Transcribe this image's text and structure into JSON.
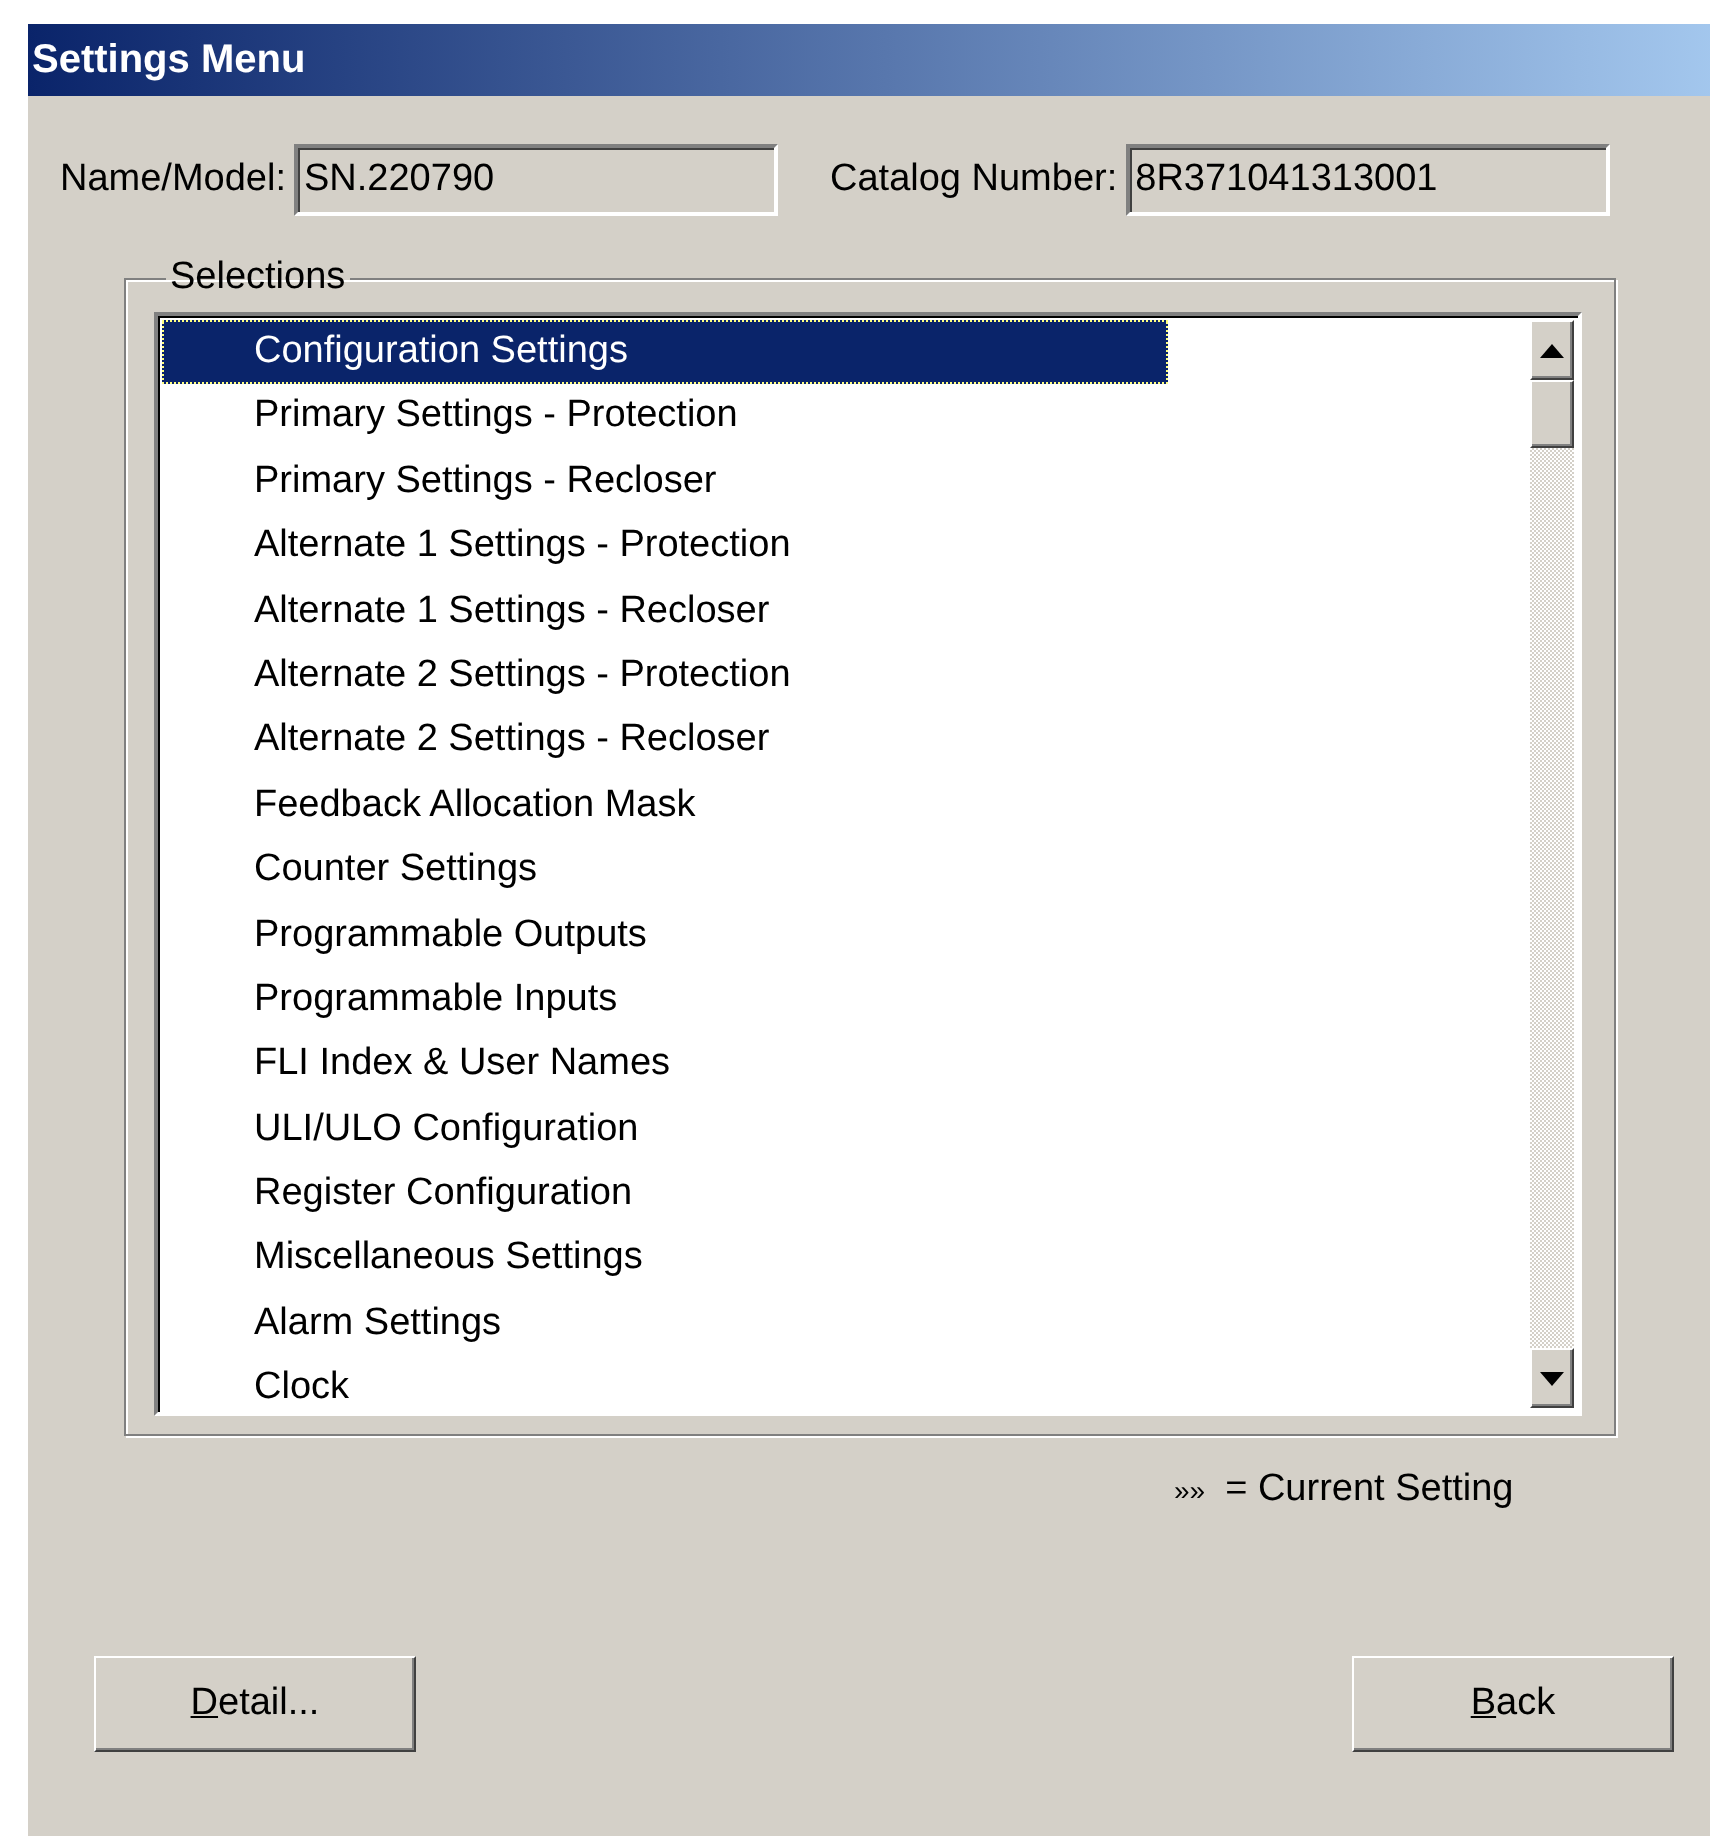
{
  "window": {
    "title": "Settings Menu"
  },
  "fields": [
    {
      "label": "Name/Model:",
      "value": "SN.220790"
    },
    {
      "label": "Catalog Number:",
      "value": "8R371041313001"
    }
  ],
  "selections": {
    "legend": "Selections",
    "items": [
      {
        "label": "Configuration Settings",
        "selected": true
      },
      {
        "label": "Primary Settings - Protection",
        "selected": false
      },
      {
        "label": "Primary Settings - Recloser",
        "selected": false
      },
      {
        "label": "Alternate 1 Settings - Protection",
        "selected": false
      },
      {
        "label": "Alternate 1 Settings - Recloser",
        "selected": false
      },
      {
        "label": "Alternate 2 Settings - Protection",
        "selected": false
      },
      {
        "label": "Alternate 2 Settings - Recloser",
        "selected": false
      },
      {
        "label": "Feedback Allocation Mask",
        "selected": false
      },
      {
        "label": "Counter Settings",
        "selected": false
      },
      {
        "label": "Programmable Outputs",
        "selected": false
      },
      {
        "label": "Programmable Inputs",
        "selected": false
      },
      {
        "label": "FLI Index & User Names",
        "selected": false
      },
      {
        "label": "ULI/ULO Configuration",
        "selected": false
      },
      {
        "label": "Register Configuration",
        "selected": false
      },
      {
        "label": "Miscellaneous Settings",
        "selected": false
      },
      {
        "label": "Alarm Settings",
        "selected": false
      },
      {
        "label": "Clock",
        "selected": false
      }
    ]
  },
  "legend_note": {
    "marker": "»»",
    "text": "= Current Setting"
  },
  "buttons": [
    {
      "access_key": "D",
      "label_rest": "etail..."
    },
    {
      "access_key": "B",
      "label_rest": "ack"
    }
  ]
}
